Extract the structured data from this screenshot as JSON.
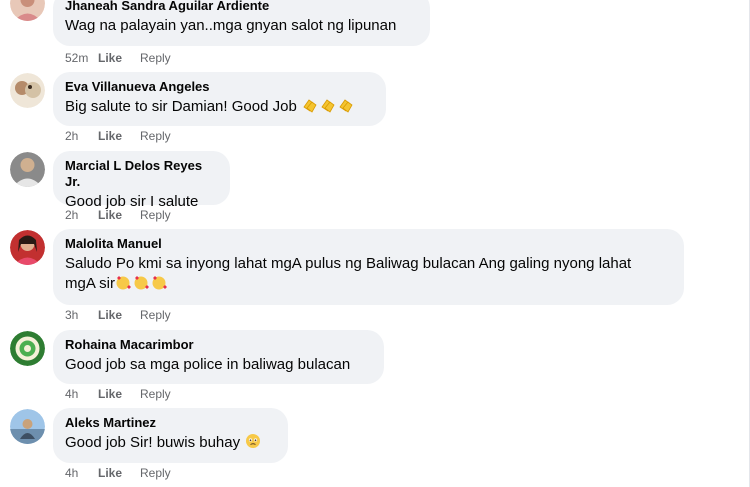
{
  "comments": [
    {
      "author": "Jhaneah Sandra Aguilar Ardiente",
      "text": "Wag na palayain yan..mga gnyan salot ng lipunan",
      "time": "52m",
      "like": "Like",
      "reply": "Reply"
    },
    {
      "author": "Eva Villanueva Angeles",
      "text": "Big salute to sir Damian! Good Job",
      "emoji_icon": "clapping-hands-emoji",
      "time": "2h",
      "like": "Like",
      "reply": "Reply"
    },
    {
      "author": "Marcial L Delos Reyes Jr.",
      "text": "Good job sir I salute",
      "time": "2h",
      "like": "Like",
      "reply": "Reply"
    },
    {
      "author": "Malolita Manuel",
      "text_line1": "Saludo Po kmi sa inyong lahat mgA pulus ng Baliwag bulacan Ang galing nyong lahat",
      "text_line2": "mgA sir",
      "emoji_icon": "smiling-face-with-hearts-emoji",
      "time": "3h",
      "like": "Like",
      "reply": "Reply"
    },
    {
      "author": "Rohaina Macarimbor",
      "text": "Good job sa mga police in baliwag bulacan",
      "time": "4h",
      "like": "Like",
      "reply": "Reply"
    },
    {
      "author": "Aleks Martinez",
      "text": "Good job Sir! buwis buhay",
      "emoji_icon": "face-holding-back-tears-emoji",
      "time": "4h",
      "like": "Like",
      "reply": "Reply"
    }
  ],
  "colors": {
    "bubble": "#f0f2f5",
    "meta": "#65676b",
    "text": "#050505"
  }
}
